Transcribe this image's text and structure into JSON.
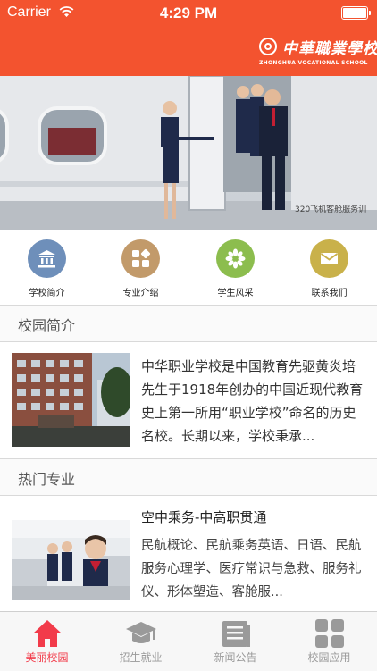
{
  "status_bar": {
    "carrier": "Carrier",
    "time": "4:29 PM"
  },
  "header": {
    "logo_text_cn": "中華職業學校",
    "logo_text_en": "ZHONGHUA VOCATIONAL SCHOOL",
    "background_color": "#f3532f"
  },
  "banner": {
    "sign_text": "320飞机客舱服务训",
    "icon": "airplane-cabin-photo"
  },
  "quick_links": [
    {
      "label": "学校简介",
      "icon": "building-icon",
      "color": "#6e8fba"
    },
    {
      "label": "专业介绍",
      "icon": "grid-icon",
      "color": "#c29a6a"
    },
    {
      "label": "学生风采",
      "icon": "flower-icon",
      "color": "#8cbd4e"
    },
    {
      "label": "联系我们",
      "icon": "mail-icon",
      "color": "#c9b14a"
    }
  ],
  "campus_intro": {
    "heading": "校园简介",
    "text": "中华职业学校是中国教育先驱黄炎培先生于1918年创办的中国近现代教育史上第一所用“职业学校”命名的历史名校。长期以来，学校秉承..."
  },
  "popular_majors": {
    "heading": "热门专业",
    "items": [
      {
        "title": "空中乘务-中高职贯通",
        "description": "民航概论、民航乘务英语、日语、民航服务心理学、医疗常识与急救、服务礼仪、形体塑造、客舱服..."
      }
    ]
  },
  "tab_bar": {
    "active_color": "#f23b4a",
    "inactive_color": "#9a9a9a",
    "tabs": [
      {
        "label": "美丽校园",
        "icon": "home-icon",
        "active": true
      },
      {
        "label": "招生就业",
        "icon": "graduation-cap-icon",
        "active": false
      },
      {
        "label": "新闻公告",
        "icon": "newspaper-icon",
        "active": false
      },
      {
        "label": "校园应用",
        "icon": "apps-grid-icon",
        "active": false
      }
    ]
  }
}
